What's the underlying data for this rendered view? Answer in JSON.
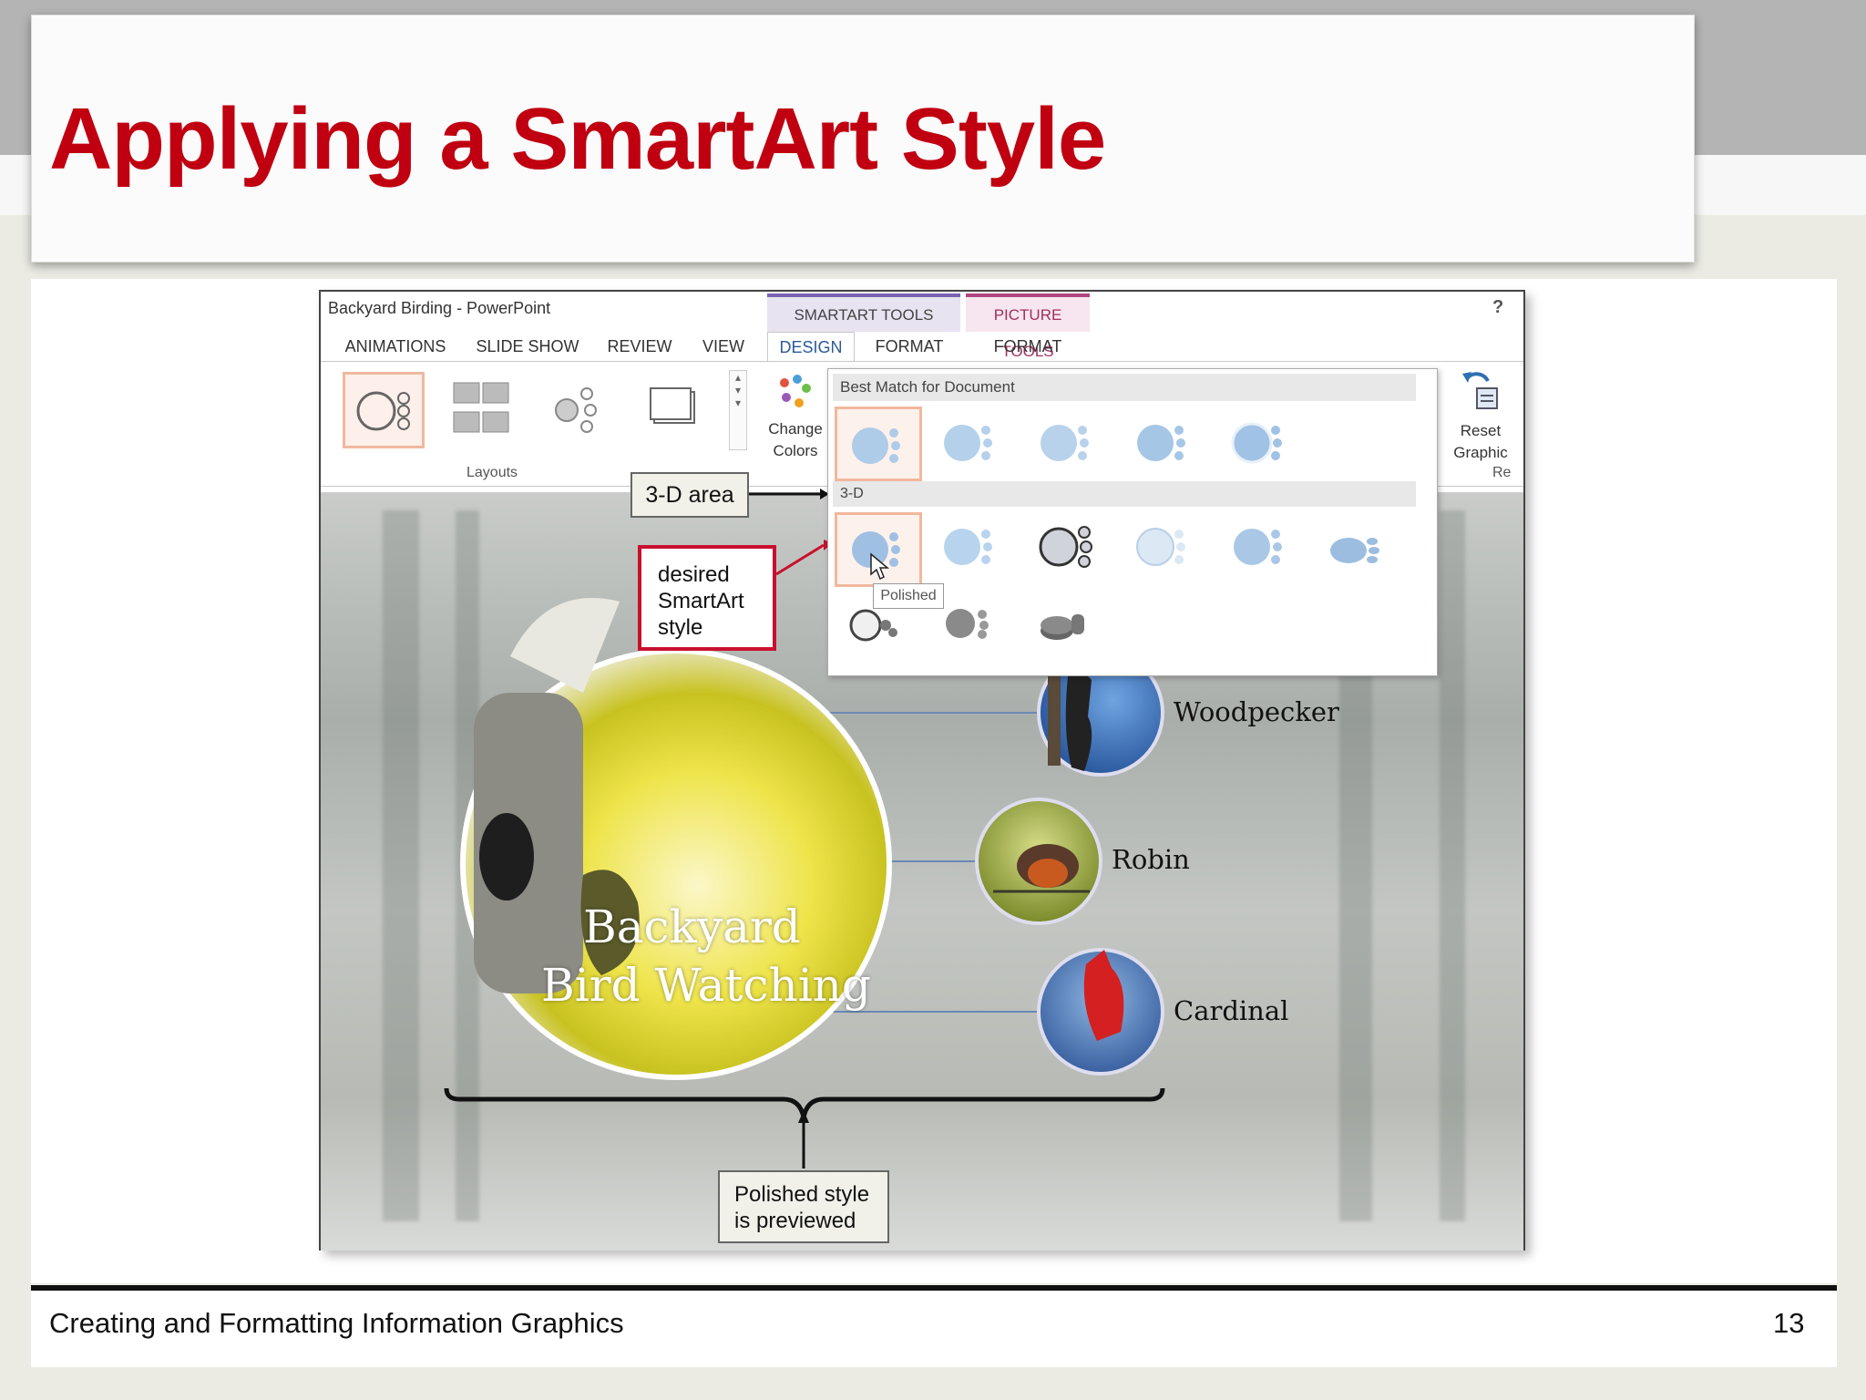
{
  "slide": {
    "title": "Applying a SmartArt Style",
    "footer_text": "Creating and Formatting Information Graphics",
    "page_number": "13"
  },
  "window": {
    "title": "Backyard Birding - PowerPoint",
    "help": "?"
  },
  "ribbon": {
    "contextual_groups": [
      "SMARTART TOOLS",
      "PICTURE TOOLS"
    ],
    "tabs": [
      "ANIMATIONS",
      "SLIDE SHOW",
      "REVIEW",
      "VIEW",
      "DESIGN",
      "FORMAT",
      "FORMAT"
    ],
    "active_tab": "DESIGN",
    "layouts_group_label": "Layouts",
    "change_colors": [
      "Change",
      "Colors"
    ],
    "reset_graphic": [
      "Reset",
      "Graphic"
    ],
    "reset_group_label": "Re"
  },
  "style_gallery": {
    "best_match_header": "Best Match for Document",
    "threed_header": "3-D",
    "tooltip": "Polished"
  },
  "slide_content": {
    "main_circle_text": [
      "Backyard",
      "Bird Watching"
    ],
    "birds": [
      "Woodpecker",
      "Robin",
      "Cardinal"
    ]
  },
  "callouts": {
    "threed_area": "3-D area",
    "desired_style": [
      "desired",
      "SmartArt",
      "style"
    ],
    "polished_preview": [
      "Polished style",
      "is previewed"
    ]
  },
  "colors": {
    "title_red": "#c00010",
    "callout_red": "#c8102e",
    "smartart_purple": "#7a63b0",
    "picture_tools_pink": "#b04680",
    "selection_orange": "#f2b79d"
  }
}
